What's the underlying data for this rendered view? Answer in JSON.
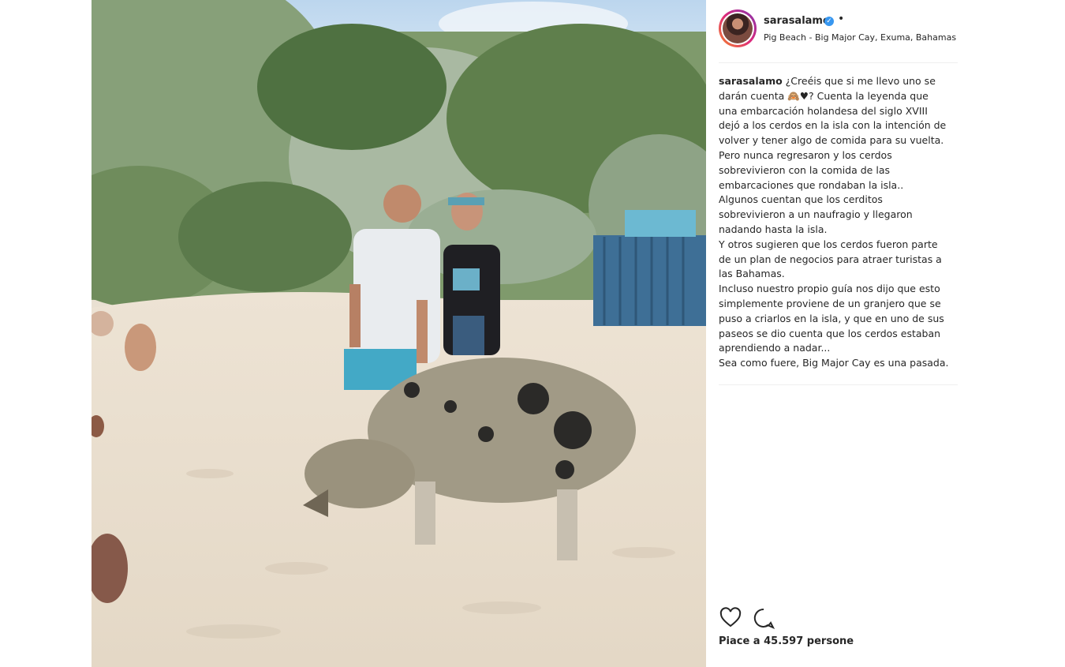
{
  "post": {
    "username": "sarasalamo",
    "dot": "•",
    "location": "Pig Beach - Big Major Cay, Exuma, Bahamas",
    "caption_lines": [
      "¿Creéis que si me llevo uno se darán cuenta 🙈♥? Cuenta la leyenda que una embarcación holandesa del siglo XVIII dejó a los cerdos en la isla con la intención de volver y tener algo de comida para su vuelta. Pero nunca regresaron y los cerdos sobrevivieron con la comida de las embarcaciones que rondaban la isla..",
      "Algunos cuentan que los cerditos sobrevivieron a un naufragio y llegaron nadando hasta la isla.",
      "Y otros sugieren que los cerdos fueron parte de un plan de negocios para atraer turistas a las Bahamas.",
      "Incluso nuestro propio guía nos dijo que esto simplemente proviene de un granjero que se puso a criarlos en la isla, y que en uno de sus paseos se dio cuenta que los cerdos estaban aprendiendo a nadar...",
      "Sea como fuere, Big Major Cay es una pasada."
    ],
    "likes_text": "Piace a 45.597 persone"
  },
  "icons": {
    "verified": "verified-badge-icon",
    "like": "heart-icon",
    "comment": "comment-bubble-icon"
  },
  "colors": {
    "verified": "#3897f0",
    "sand": "#e9dfd0",
    "sky": "#cfe3f3",
    "foliage": "#6d8c5a"
  }
}
